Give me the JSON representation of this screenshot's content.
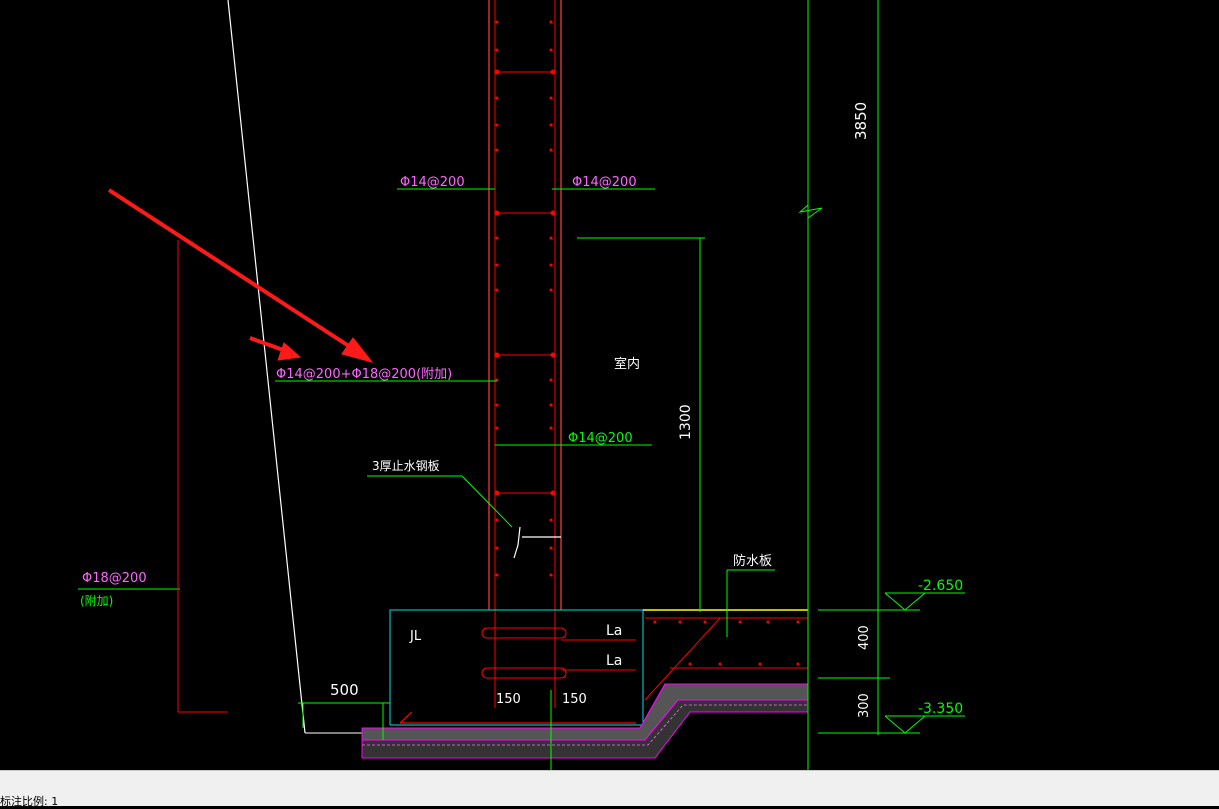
{
  "drawing": {
    "labels": {
      "rebar_left_upper": "Φ14@200",
      "rebar_right_upper": "Φ14@200",
      "rebar_left_main": "Φ14@200+Φ18@200(附加)",
      "rebar_right_lower": "Φ14@200",
      "rebar_additional": "Φ18@200",
      "rebar_additional_note": "(附加)",
      "waterstop": "3厚止水钢板",
      "indoor": "室内",
      "beam": "JL",
      "anchor_1": "La",
      "anchor_2": "La",
      "width_left": "150",
      "width_right": "150",
      "offset": "500",
      "waterproof_slab": "防水板",
      "dim_total": "3850",
      "dim_1300": "1300",
      "dim_400": "400",
      "dim_300": "300",
      "elev_top": "-2.650",
      "elev_bottom": "-3.350"
    },
    "colors": {
      "background": "#000000",
      "rebar": "#ff0000",
      "dimension": "#00ff00",
      "annotation_magenta": "#ff00ff",
      "outline_cyan": "#00ffff",
      "outline_white": "#ffffff",
      "slab_yellow": "#ffff00",
      "highlight_arrow": "#ff1a1a"
    }
  },
  "statusbar": {
    "text": "标注比例: 1"
  }
}
